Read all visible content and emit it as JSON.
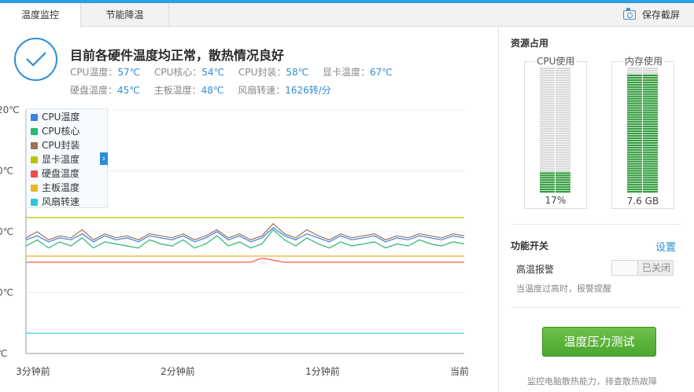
{
  "tabs": [
    {
      "label": "温度监控",
      "active": true
    },
    {
      "label": "节能降温",
      "active": false
    }
  ],
  "toolbar": {
    "save_label": "保存截屏",
    "icon": "camera-icon"
  },
  "status": {
    "icon": "check-icon",
    "title": "目前各硬件温度均正常，散热情况良好",
    "row1": [
      {
        "label": "CPU温度：",
        "value": "57℃"
      },
      {
        "label": "CPU核心：",
        "value": "54℃"
      },
      {
        "label": "CPU封装：",
        "value": "58℃"
      },
      {
        "label": "显卡温度：",
        "value": "67℃"
      }
    ],
    "row2": [
      {
        "label": "硬盘温度：",
        "value": "45℃"
      },
      {
        "label": "主板温度：",
        "value": "48℃"
      },
      {
        "label": "风扇转速：",
        "value": "1626转/分"
      }
    ]
  },
  "chart_data": {
    "type": "line",
    "y_tick_labels": [
      "20℃",
      "0℃",
      "0℃",
      "0℃",
      "℃"
    ],
    "x_tick_labels": [
      "3分钟前",
      "2分钟前",
      "1分钟前",
      "当前"
    ],
    "legend_placement": "top-left",
    "grid": true,
    "legend": [
      {
        "name": "CPU温度",
        "color": "#3b7fe0"
      },
      {
        "name": "CPU核心",
        "color": "#2bb673"
      },
      {
        "name": "CPU封装",
        "color": "#a0705a"
      },
      {
        "name": "显卡温度",
        "color": "#b5c400"
      },
      {
        "name": "硬盘温度",
        "color": "#ef4b4b"
      },
      {
        "name": "主板温度",
        "color": "#f0b429"
      },
      {
        "name": "风扇转速",
        "color": "#2ec7d9"
      }
    ],
    "series": [
      {
        "name": "显卡温度",
        "values": [
          67,
          67,
          67,
          67,
          67,
          67,
          67,
          67,
          67,
          67,
          67,
          67,
          67,
          67,
          67,
          67,
          67,
          67,
          67,
          67,
          67,
          67,
          67,
          67,
          67,
          67,
          67,
          67,
          67,
          67,
          67,
          67,
          67,
          67,
          67,
          67,
          67,
          67,
          67,
          67
        ]
      },
      {
        "name": "CPU温度",
        "values": [
          56,
          58,
          55,
          57,
          56,
          59,
          55,
          58,
          56,
          57,
          55,
          58,
          57,
          56,
          58,
          55,
          57,
          60,
          56,
          58,
          55,
          57,
          62,
          58,
          56,
          59,
          57,
          55,
          58,
          56,
          57,
          58,
          55,
          57,
          56,
          58,
          57,
          56,
          58,
          57
        ]
      },
      {
        "name": "CPU核心",
        "values": [
          53,
          56,
          52,
          55,
          53,
          57,
          52,
          55,
          54,
          53,
          52,
          56,
          54,
          53,
          56,
          52,
          54,
          58,
          53,
          55,
          52,
          54,
          61,
          56,
          53,
          57,
          54,
          52,
          55,
          53,
          54,
          55,
          52,
          54,
          53,
          56,
          54,
          53,
          55,
          54
        ]
      },
      {
        "name": "CPU封装",
        "values": [
          57,
          60,
          56,
          58,
          57,
          61,
          56,
          59,
          57,
          58,
          56,
          59,
          58,
          57,
          59,
          56,
          58,
          61,
          57,
          59,
          56,
          58,
          64,
          59,
          57,
          61,
          58,
          56,
          59,
          57,
          58,
          59,
          56,
          58,
          57,
          59,
          58,
          57,
          59,
          58
        ]
      },
      {
        "name": "主板温度",
        "values": [
          48,
          48,
          48,
          48,
          48,
          48,
          48,
          48,
          48,
          48,
          48,
          48,
          48,
          48,
          48,
          48,
          48,
          48,
          48,
          48,
          48,
          48,
          48,
          48,
          48,
          48,
          48,
          48,
          48,
          48,
          48,
          48,
          48,
          48,
          48,
          48,
          48,
          48,
          48,
          48
        ]
      },
      {
        "name": "硬盘温度",
        "values": [
          45,
          45,
          45,
          45,
          45,
          45,
          45,
          45,
          45,
          45,
          45,
          45,
          45,
          45,
          45,
          45,
          45,
          45,
          45,
          45,
          45,
          47,
          46,
          45,
          45,
          45,
          45,
          45,
          45,
          45,
          45,
          45,
          45,
          45,
          45,
          45,
          45,
          45,
          45,
          45
        ]
      },
      {
        "name": "风扇转速",
        "values": [
          10,
          10,
          10,
          10,
          10,
          10,
          10,
          10,
          10,
          10,
          10,
          10,
          10,
          10,
          10,
          10,
          10,
          10,
          10,
          10,
          10,
          10,
          10,
          10,
          10,
          10,
          10,
          10,
          10,
          10,
          10,
          10,
          10,
          10,
          10,
          10,
          10,
          10,
          10,
          10
        ]
      }
    ],
    "ylim": [
      0,
      120
    ]
  },
  "resources": {
    "title": "资源占用",
    "cpu": {
      "label": "CPU使用",
      "value": "17%",
      "fraction": 0.17
    },
    "memory": {
      "label": "内存使用",
      "value": "7.6 GB",
      "fraction": 0.95
    }
  },
  "features": {
    "title": "功能开关",
    "settings_label": "设置",
    "alarm_label": "高温报警",
    "alarm_toggle": "已关闭",
    "alarm_desc": "当温度过高时，报警提醒"
  },
  "stress": {
    "button_label": "温度压力测试",
    "desc": "监控电脑散热能力，排查散热故障"
  },
  "colors": {
    "accent": "#2b8ed8",
    "bar_green": "#2f9a3a",
    "button_green": "#5bb63b"
  }
}
